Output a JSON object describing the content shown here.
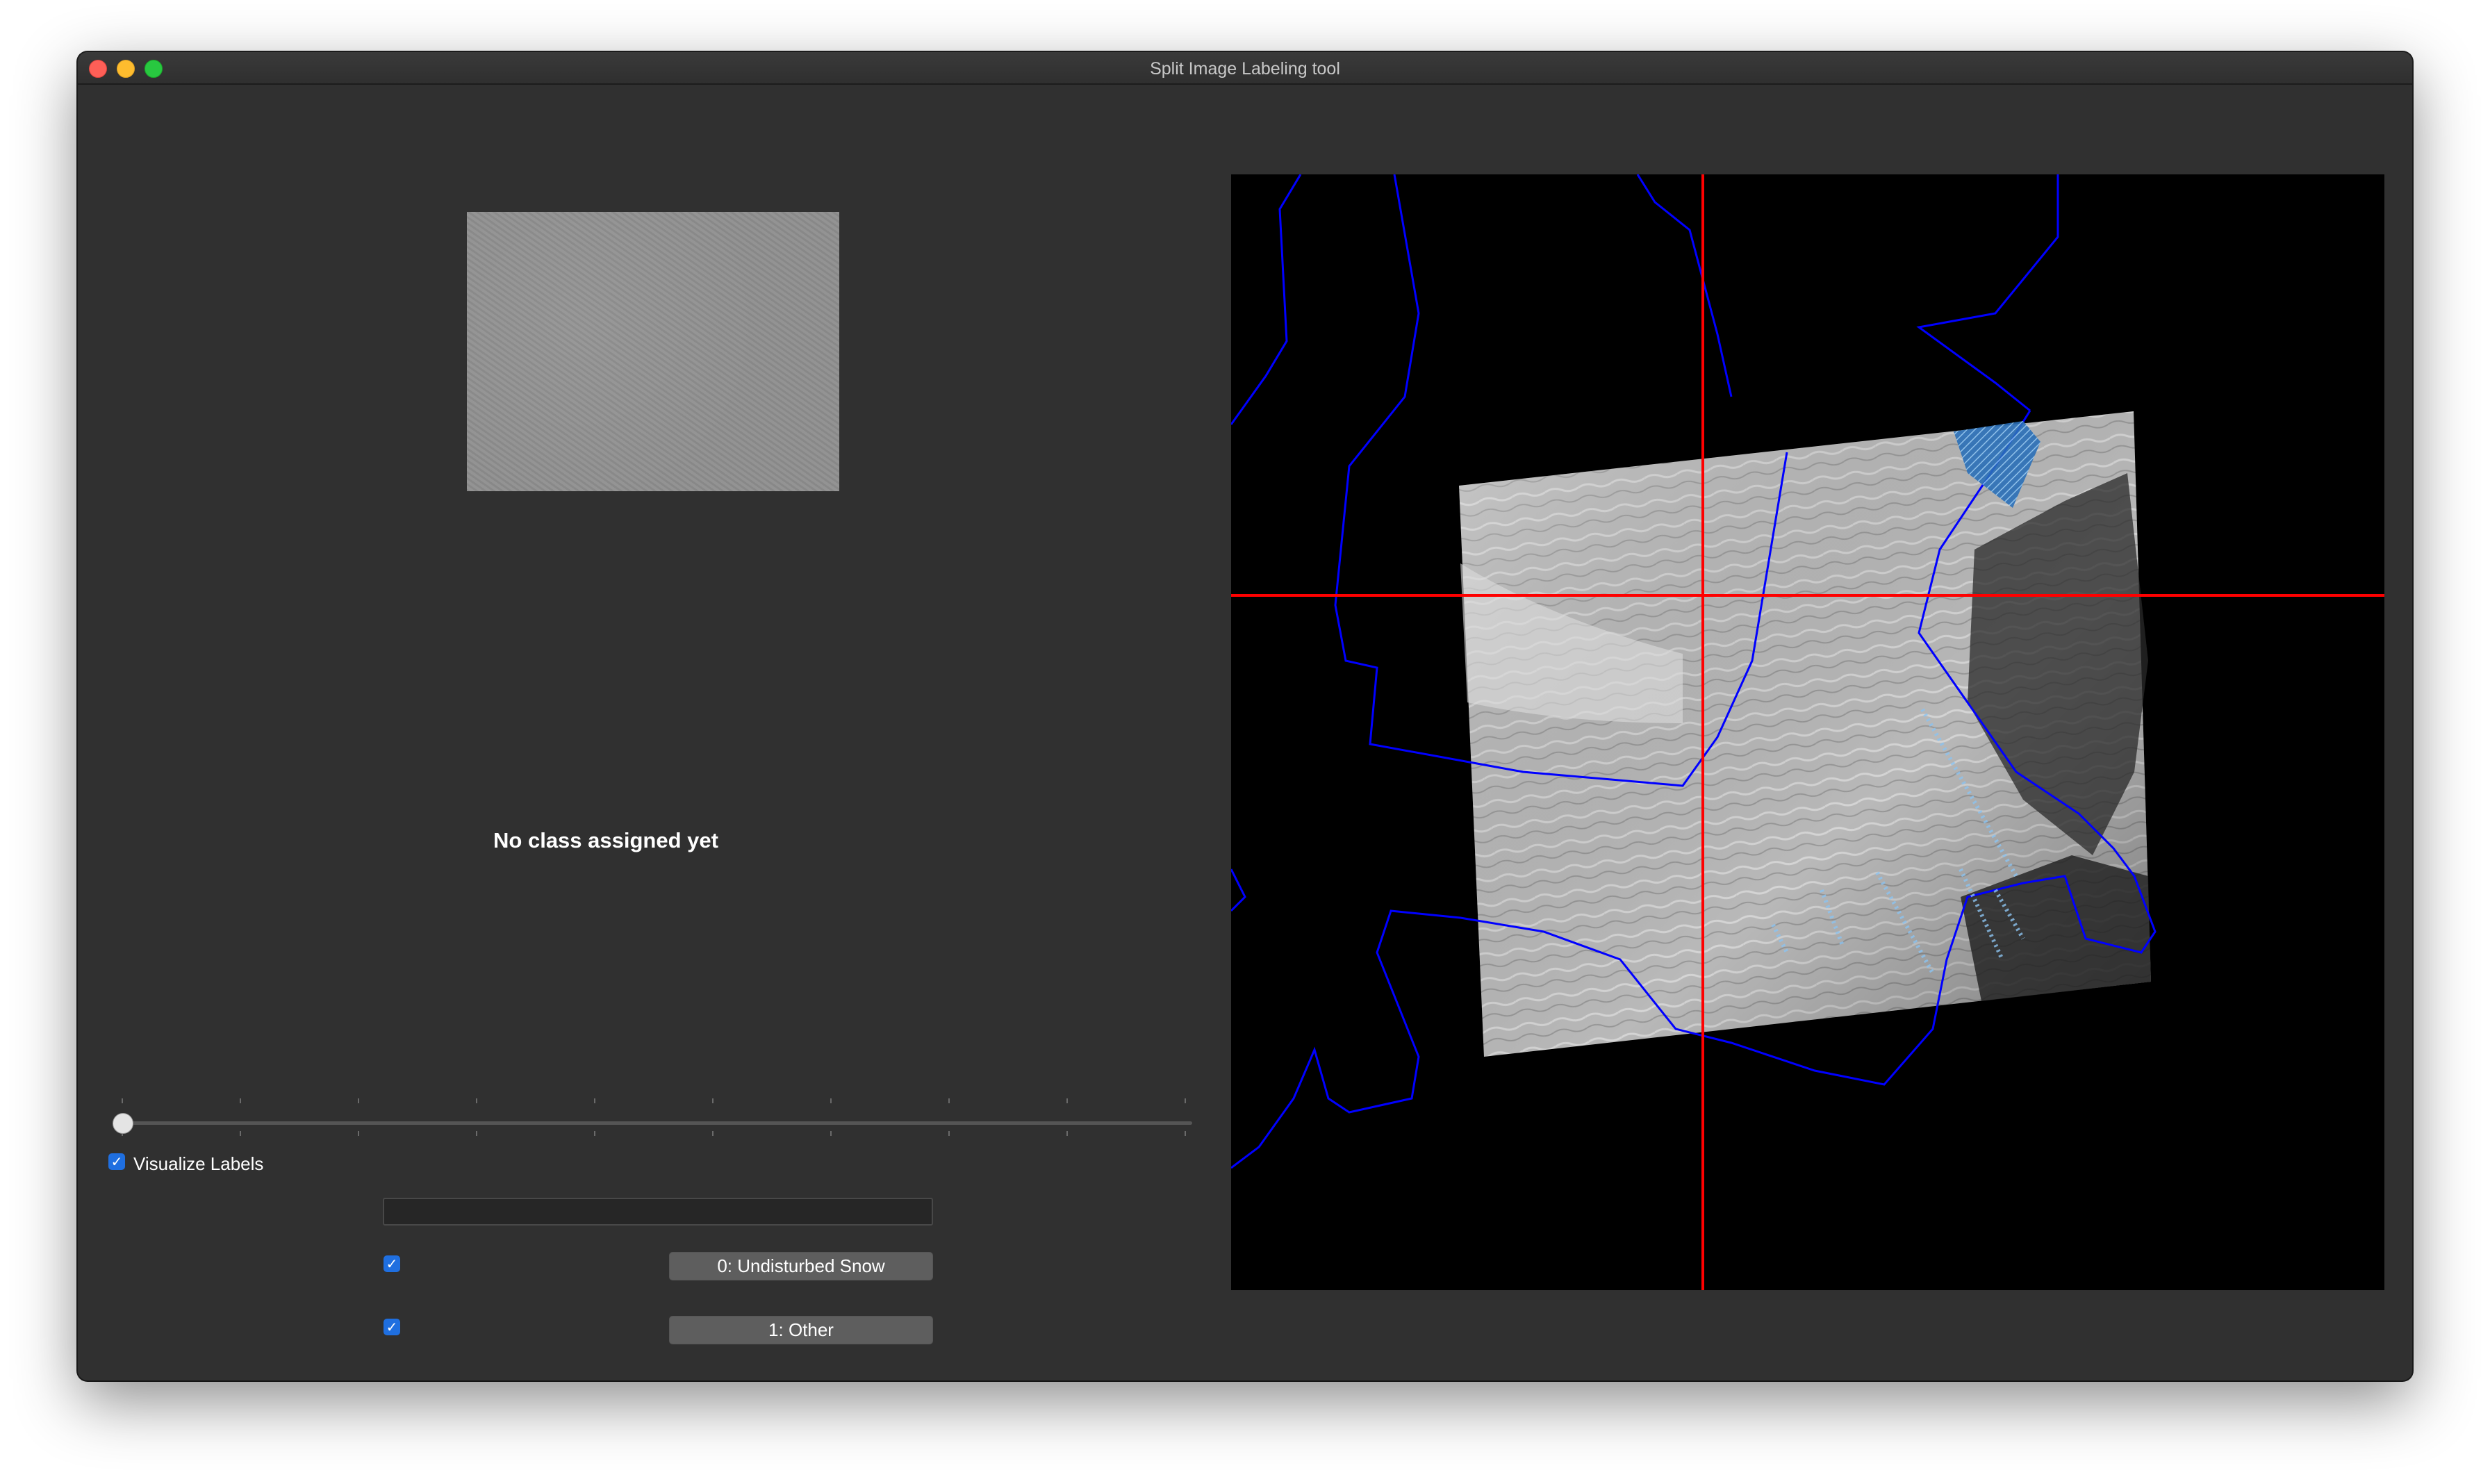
{
  "window": {
    "title": "Split Image Labeling tool"
  },
  "left_panel": {
    "class_status": "No class assigned yet",
    "slider": {
      "value": 0,
      "min": 0,
      "max": 9
    },
    "visualize_labels": {
      "label": "Visualize Labels",
      "checked": true
    },
    "class_input": {
      "value": ""
    },
    "classes": [
      {
        "label": "0: Undisturbed Snow",
        "checked": true
      },
      {
        "label": "1: Other",
        "checked": true
      }
    ]
  },
  "map": {
    "crosshair_color": "#ff0000",
    "outline_color": "#0000ff",
    "label_color": "#3a8fd8"
  },
  "colors": {
    "window_bg": "#303030",
    "checkbox_accent": "#1f6fe0"
  }
}
